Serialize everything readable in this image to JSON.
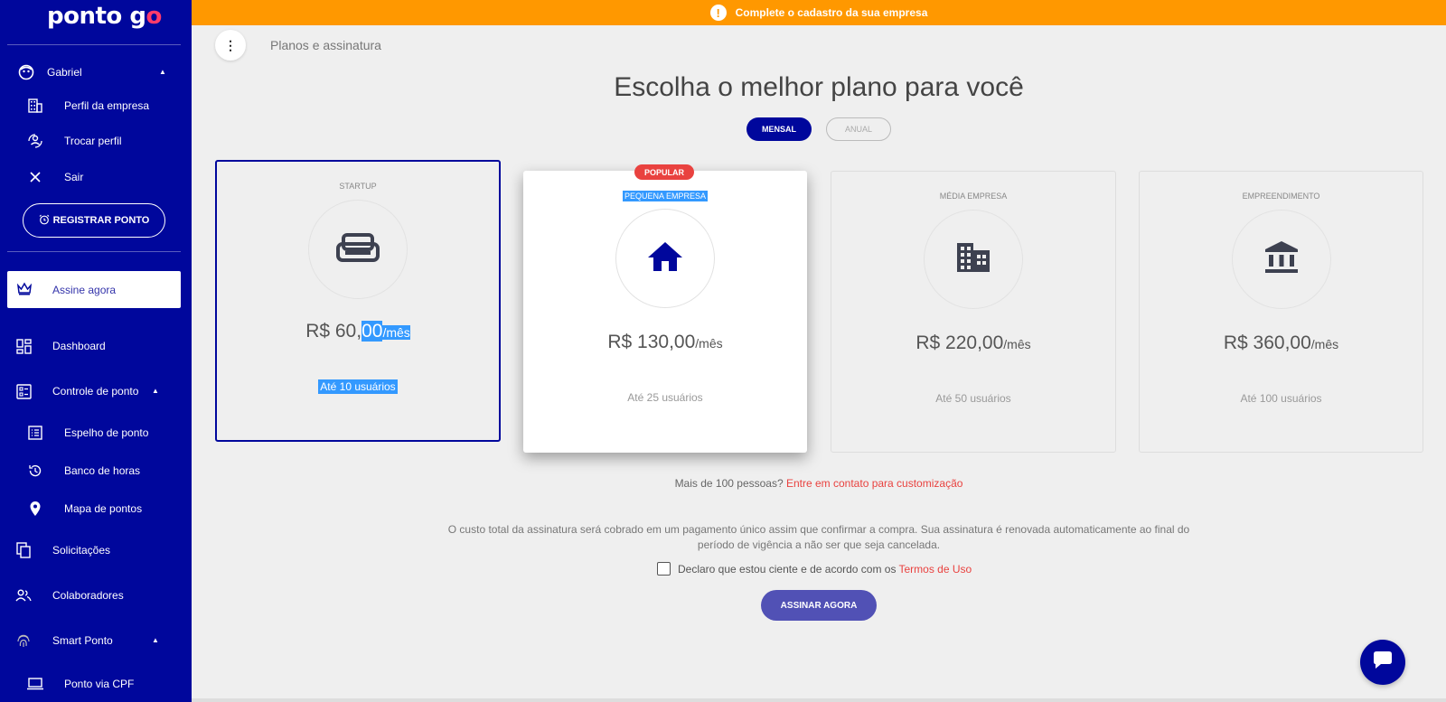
{
  "app": {
    "logo_text": "ponto g",
    "logo_accent": "o"
  },
  "banner": {
    "icon": "exclamation-icon",
    "text": "Complete o cadastro da sua empresa"
  },
  "sidebar": {
    "user_name": "Gabriel",
    "user_items": [
      {
        "label": "Perfil da empresa",
        "icon": "building-icon"
      },
      {
        "label": "Trocar perfil",
        "icon": "switch-profile-icon"
      },
      {
        "label": "Sair",
        "icon": "close-icon"
      }
    ],
    "register_button": "REGISTRAR PONTO",
    "subscribe_now": "Assine agora",
    "nav": [
      {
        "label": "Dashboard",
        "icon": "dashboard-icon"
      },
      {
        "label": "Controle de ponto",
        "icon": "timesheet-icon"
      },
      {
        "label": "Espelho de ponto",
        "icon": "list-icon"
      },
      {
        "label": "Banco de horas",
        "icon": "history-icon"
      },
      {
        "label": "Mapa de pontos",
        "icon": "map-pin-icon"
      },
      {
        "label": "Solicitações",
        "icon": "copy-icon"
      },
      {
        "label": "Colaboradores",
        "icon": "people-icon"
      },
      {
        "label": "Smart Ponto",
        "icon": "fingerprint-icon"
      },
      {
        "label": "Ponto via CPF",
        "icon": "laptop-icon"
      }
    ]
  },
  "header": {
    "breadcrumb": "Planos e assinatura",
    "menu_icon": "more-vertical-icon"
  },
  "main": {
    "headline": "Escolha o melhor plano para você",
    "billing_toggle": {
      "monthly": "MENSAL",
      "yearly": "ANUAL",
      "selected": "MENSAL"
    },
    "popular_badge": "POPULAR",
    "plans": [
      {
        "name": "STARTUP",
        "price_main": "R$ 60,",
        "price_cents": "00",
        "per": "/mês",
        "users": "Até 10 usuários",
        "icon": "sofa-icon"
      },
      {
        "name": "PEQUENA EMPRESA",
        "price_main": "R$ 130,00",
        "per": "/mês",
        "users": "Até 25 usuários",
        "icon": "home-icon"
      },
      {
        "name": "MÉDIA EMPRESA",
        "price_main": "R$ 220,00",
        "per": "/mês",
        "users": "Até 50 usuários",
        "icon": "building-icon"
      },
      {
        "name": "EMPREENDIMENTO",
        "price_main": "R$ 360,00",
        "per": "/mês",
        "users": "Até 100 usuários",
        "icon": "bank-icon"
      }
    ],
    "contact_prefix": "Mais de 100 pessoas?",
    "contact_link": "Entre em contato para customização",
    "billing_note": "O custo total da assinatura será cobrado em um pagamento único assim que confirmar a compra. Sua assinatura é renovada automaticamente ao final do período de vigência a não ser que seja cancelada.",
    "terms_text": "Declaro que estou ciente e de acordo com os",
    "terms_link": "Termos de Uso",
    "subscribe_button": "ASSINAR AGORA"
  },
  "chat": {
    "icon": "chat-icon"
  },
  "colors": {
    "brand": "#00079c",
    "banner": "#ff9800",
    "accent_red": "#e9423f",
    "subscribe": "#5151b5"
  }
}
